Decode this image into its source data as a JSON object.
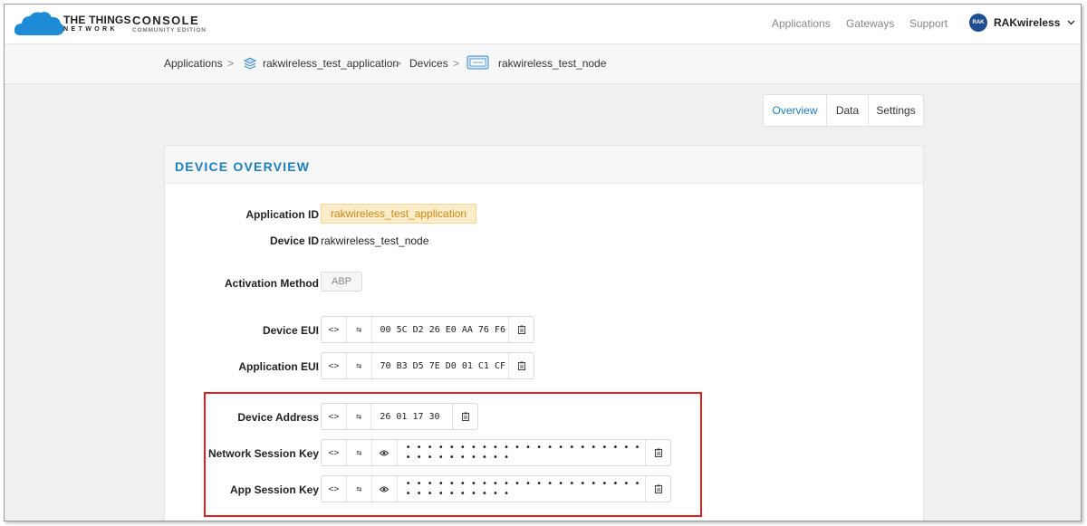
{
  "brand": {
    "name": "THE THINGS",
    "sub": "NETWORK",
    "console": "CONSOLE",
    "edition": "COMMUNITY EDITION"
  },
  "nav": {
    "applications": "Applications",
    "gateways": "Gateways",
    "support": "Support",
    "user": "RAKwireless",
    "avatar_text": "RAK"
  },
  "breadcrumb": {
    "applications": "Applications",
    "application": "rakwireless_test_application",
    "devices": "Devices",
    "device": "rakwireless_test_node",
    "separator": ">"
  },
  "tabs": [
    "Overview",
    "Data",
    "Settings"
  ],
  "panel_title": "DEVICE OVERVIEW",
  "fields": {
    "application_id": {
      "label": "Application ID",
      "value": "rakwireless_test_application"
    },
    "device_id": {
      "label": "Device ID",
      "value": "rakwireless_test_node"
    },
    "activation": {
      "label": "Activation Method",
      "value": "ABP"
    },
    "device_eui": {
      "label": "Device EUI",
      "value": "00 5C D2 26 E0 AA 76 F6"
    },
    "app_eui": {
      "label": "Application EUI",
      "value": "70 B3 D5 7E D0 01 C1 CF"
    },
    "dev_addr": {
      "label": "Device Address",
      "value": "26 01 17 30"
    },
    "nwk_skey": {
      "label": "Network Session Key",
      "value": "• • • • • • • • • • • • • • • • • • • • • • • • • • • • • • • •"
    },
    "app_skey": {
      "label": "App Session Key",
      "value": "• • • • • • • • • • • • • • • • • • • • • • • • • • • • • • • •"
    }
  },
  "icons": {
    "format": "<>",
    "swap": "⇆",
    "eye": "eye-icon",
    "copy": "clipboard-icon"
  },
  "colors": {
    "accent": "#1d7fc1",
    "highlight": "#e02020",
    "tag_bg": "#fdecc8",
    "tag_text": "#c88a16"
  }
}
